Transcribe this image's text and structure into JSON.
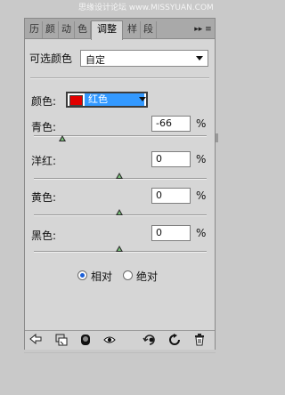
{
  "watermark": "思缘设计论坛 www.MISSYUAN.COM",
  "tabs": [
    {
      "label": "历"
    },
    {
      "label": "颜"
    },
    {
      "label": "动"
    },
    {
      "label": "色"
    },
    {
      "label": "调整"
    },
    {
      "label": "样"
    },
    {
      "label": "段"
    }
  ],
  "tab_menu_label": "▸▸ ≡",
  "preset": {
    "label": "可选颜色",
    "value": "自定"
  },
  "colors": {
    "label": "颜色:",
    "selected": "红色",
    "swatch_color": "#e10000"
  },
  "sliders": [
    {
      "label": "青色:",
      "value": "-66",
      "unit": "%",
      "level": -0.66
    },
    {
      "label": "洋红:",
      "value": "0",
      "unit": "%",
      "level": 0
    },
    {
      "label": "黄色:",
      "value": "0",
      "unit": "%",
      "level": 0
    },
    {
      "label": "黑色:",
      "value": "0",
      "unit": "%",
      "level": 0
    }
  ],
  "method": {
    "relative_label": "相对",
    "absolute_label": "绝对",
    "selected": "relative"
  },
  "toolbar_icons": [
    "back-arrow-icon",
    "clip-layer-icon",
    "mask-visibility-icon",
    "eye-icon",
    "view-previous-icon",
    "reset-icon",
    "trash-icon"
  ],
  "accent_color": "#3399ff"
}
